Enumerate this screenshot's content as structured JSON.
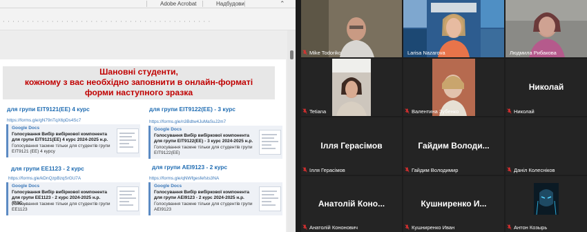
{
  "document": {
    "ribbon": {
      "tabs": [
        "Adobe Acrobat",
        "Надбудови"
      ]
    },
    "header_lines": [
      "Шановні студенти,",
      "кожному з вас необхідно заповнити в онлайн-форматі",
      "форми наступного зразка"
    ],
    "groups": [
      {
        "label": "для групи ЕІТ9121(ЕЕ) 4 курс",
        "link": "https://forms.gle/gN79nTqX6pDs4Sc7",
        "card_site": "Google Docs",
        "card_title": "Голосування Вибір вибіркової компонента для групи ЕІТ9121(ЕЕ) 4 курс 2024-2025 н.р.",
        "card_desc": "Голосування таємне тільки для студентів групи ЕІТ9121 (ЕЕ) 4 курсу"
      },
      {
        "label": "для групи ЕІТ9122(ЕЕ) - 3 курс",
        "link": "https://forms.gle/n3Bdtw4JuMaSuJ2m7",
        "card_site": "Google Docs",
        "card_title": "Голосування Вибір вибіркової компонента для групи ЕІТ9122(ЕЕ) - 3 курс 2024-2025 н.р.",
        "card_desc": "Голосування таємне тільки для студентів групи ЕІТ9122(ЕЕ)"
      },
      {
        "label": "для групи ЕЕ1123 - 2 курс",
        "link": "https://forms.gle/kDnQzpBzqSrGU7A",
        "card_site": "Google Docs",
        "card_title": "Голосування Вибір вибіркової компонента для групи ЕЕ1123 - 2 курс 2024-2025 н.р. (ПЗС...",
        "card_desc": "Голосування таємне тільки для студентів групи ЕЕ1123"
      },
      {
        "label": "для групи АЕІ9123 - 2 курс",
        "link": "https://forms.gle/qNWfgesfefsts3NA",
        "card_site": "Google Docs",
        "card_title": "Голосування Вибір вибіркової компонента для групи АЕІ9123 - 2 курс 2024-2025 н.р.",
        "card_desc": "Голосування таємне тільки для студентів групи АЕІ9123"
      }
    ]
  },
  "participants": [
    {
      "name": "Mike Todoriko",
      "video": true,
      "muted": true
    },
    {
      "name": "Larisa Nazarova",
      "video": true,
      "muted": false
    },
    {
      "name": "Людмила Рибакова",
      "video": true,
      "muted": false,
      "active_speaker": true
    },
    {
      "name": "Tetiana",
      "video": true,
      "muted": true
    },
    {
      "name": "Валентина Зубенко",
      "video": true,
      "muted": true
    },
    {
      "name": "Николай",
      "video": false,
      "muted": true,
      "display_label": "Николай"
    },
    {
      "name": "Ілля Герасімов",
      "video": false,
      "muted": true,
      "display_label": "Ілля Герасімов"
    },
    {
      "name": "Гайдим Володимир",
      "video": false,
      "muted": true,
      "display_label": "Гайдим  Володи..."
    },
    {
      "name": "Даніл Колеснiков",
      "video": false,
      "muted": true,
      "display_label": ""
    },
    {
      "name": "Анатолій Кононович",
      "video": false,
      "muted": true,
      "display_label": "Анатолій  Коно..."
    },
    {
      "name": "Кушниренко Иван",
      "video": false,
      "muted": true,
      "display_label": "Кушниренко  И..."
    },
    {
      "name": "Антон Козырь",
      "video": true,
      "muted": true
    }
  ],
  "colors": {
    "header_red": "#c00000",
    "group_blue": "#1f6cb2",
    "mic_off_red": "#e03030",
    "active_speaker": "#d9cf3a"
  },
  "icons": [
    "mic-off-icon",
    "chevron-up-icon"
  ]
}
